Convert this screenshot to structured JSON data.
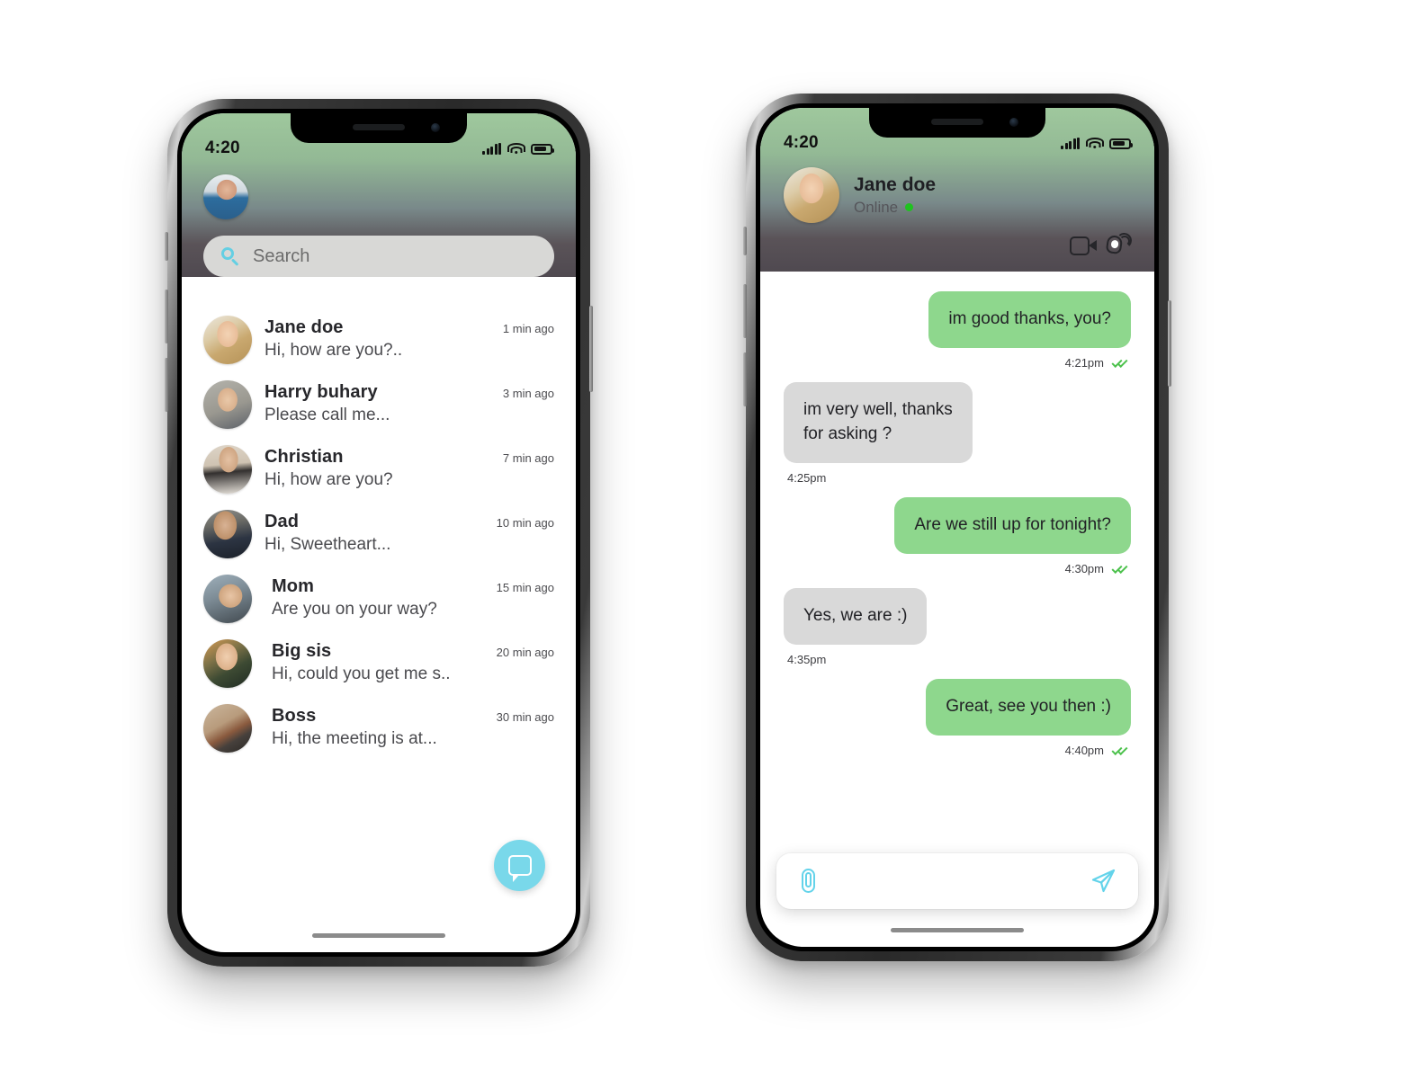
{
  "colors": {
    "accent_cyan": "#79d8ea",
    "bubble_sent_green": "#8ed78d",
    "bubble_received_gray": "#d9d9d9",
    "header_gradient_top": "#9fc89d",
    "header_gradient_bottom": "#4f4950",
    "online_green": "#1fc21f",
    "search_field": "#d8d8d6"
  },
  "phone_list": {
    "status_bar": {
      "time": "4:20",
      "signal_icon": "cellular-bars-icon",
      "wifi_icon": "wifi-icon",
      "battery_icon": "battery-icon"
    },
    "profile_avatar": "user-avatar",
    "search": {
      "placeholder": "Search",
      "value": "",
      "icon": "search-icon"
    },
    "conversations": [
      {
        "name": "Jane doe",
        "preview": "Hi, how are you?..",
        "time": "1 min ago",
        "avatar": "avatar-jane"
      },
      {
        "name": "Harry buhary",
        "preview": "Please call me...",
        "time": "3 min ago",
        "avatar": "avatar-harry"
      },
      {
        "name": "Christian",
        "preview": "Hi, how are you?",
        "time": "7 min ago",
        "avatar": "avatar-christian"
      },
      {
        "name": "Dad",
        "preview": "Hi, Sweetheart...",
        "time": "10 min ago",
        "avatar": "avatar-dad"
      },
      {
        "name": "Mom",
        "preview": "Are you on your way?",
        "time": "15 min ago",
        "avatar": "avatar-mom"
      },
      {
        "name": "Big sis",
        "preview": "Hi, could you get me s..",
        "time": "20 min ago",
        "avatar": "avatar-bigsis"
      },
      {
        "name": "Boss",
        "preview": "Hi, the meeting is at...",
        "time": "30 min ago",
        "avatar": "avatar-boss"
      }
    ],
    "fab": {
      "icon": "new-chat-bubble-icon",
      "label": ""
    }
  },
  "phone_chat": {
    "status_bar": {
      "time": "4:20",
      "signal_icon": "cellular-bars-icon",
      "wifi_icon": "wifi-icon",
      "battery_icon": "battery-icon"
    },
    "contact": {
      "name": "Jane doe",
      "status": "Online",
      "avatar": "avatar-jane"
    },
    "actions": [
      {
        "name": "video-call-button",
        "icon": "video-camera-icon"
      },
      {
        "name": "voice-call-button",
        "icon": "phone-call-icon"
      }
    ],
    "messages": [
      {
        "text": "im good thanks, you?",
        "side": "out",
        "time": "4:21pm",
        "read": true
      },
      {
        "text": "im very well, thanks\nfor asking ?",
        "side": "in",
        "time": "4:25pm",
        "read": false
      },
      {
        "text": "Are we still up for tonight?",
        "side": "out",
        "time": "4:30pm",
        "read": true
      },
      {
        "text": "Yes, we are :)",
        "side": "in",
        "time": "4:35pm",
        "read": false
      },
      {
        "text": "Great, see you then :)",
        "side": "out",
        "time": "4:40pm",
        "read": true
      }
    ],
    "composer": {
      "placeholder": "",
      "value": "",
      "attach_icon": "paperclip-icon",
      "send_icon": "send-paper-plane-icon"
    }
  }
}
